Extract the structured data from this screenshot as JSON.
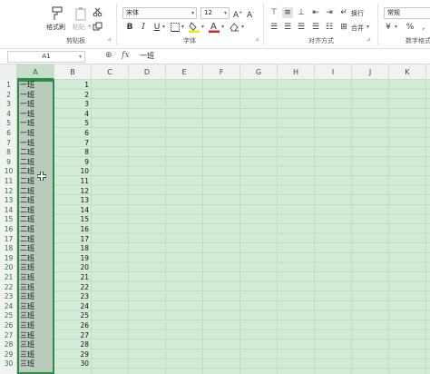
{
  "ribbon": {
    "clipboard": {
      "format_painter": "格式刷",
      "paste": "粘贴",
      "group_label": "剪贴板"
    },
    "font": {
      "font_name": "宋体",
      "font_size": "12",
      "group_label": "字体"
    },
    "alignment": {
      "wrap": "换行",
      "merge": "合并",
      "group_label": "对齐方式"
    },
    "number": {
      "format": "常规",
      "group_label": "数字格式"
    },
    "colors": {
      "highlight": "#f5e400",
      "font_color": "#e02020"
    }
  },
  "formula_bar": {
    "cell_ref": "A1",
    "content": "一班"
  },
  "columns": [
    "A",
    "B",
    "C",
    "D",
    "E",
    "F",
    "G",
    "H",
    "I",
    "J",
    "K"
  ],
  "selected_column": "A",
  "rows": [
    {
      "n": "1",
      "a": "一班",
      "b": "1"
    },
    {
      "n": "2",
      "a": "一班",
      "b": "2"
    },
    {
      "n": "3",
      "a": "一班",
      "b": "3"
    },
    {
      "n": "4",
      "a": "一班",
      "b": "4"
    },
    {
      "n": "5",
      "a": "一班",
      "b": "5"
    },
    {
      "n": "6",
      "a": "一班",
      "b": "6"
    },
    {
      "n": "7",
      "a": "一班",
      "b": "7"
    },
    {
      "n": "8",
      "a": "二班",
      "b": "8"
    },
    {
      "n": "9",
      "a": "二班",
      "b": "9"
    },
    {
      "n": "10",
      "a": "二班",
      "b": "10"
    },
    {
      "n": "11",
      "a": "二班",
      "b": "11"
    },
    {
      "n": "12",
      "a": "二班",
      "b": "12"
    },
    {
      "n": "13",
      "a": "二班",
      "b": "13"
    },
    {
      "n": "14",
      "a": "二班",
      "b": "14"
    },
    {
      "n": "15",
      "a": "二班",
      "b": "15"
    },
    {
      "n": "16",
      "a": "二班",
      "b": "16"
    },
    {
      "n": "17",
      "a": "二班",
      "b": "17"
    },
    {
      "n": "18",
      "a": "二班",
      "b": "18"
    },
    {
      "n": "19",
      "a": "二班",
      "b": "19"
    },
    {
      "n": "20",
      "a": "三班",
      "b": "20"
    },
    {
      "n": "21",
      "a": "三班",
      "b": "21"
    },
    {
      "n": "22",
      "a": "三班",
      "b": "22"
    },
    {
      "n": "23",
      "a": "三班",
      "b": "23"
    },
    {
      "n": "24",
      "a": "三班",
      "b": "24"
    },
    {
      "n": "25",
      "a": "三班",
      "b": "25"
    },
    {
      "n": "26",
      "a": "三班",
      "b": "26"
    },
    {
      "n": "27",
      "a": "三班",
      "b": "27"
    },
    {
      "n": "28",
      "a": "三班",
      "b": "28"
    },
    {
      "n": "29",
      "a": "三班",
      "b": "29"
    },
    {
      "n": "30",
      "a": "三班",
      "b": "30"
    }
  ],
  "colors": {
    "accent": "#2e8b4a",
    "grid_background": "#d2ecd7"
  }
}
